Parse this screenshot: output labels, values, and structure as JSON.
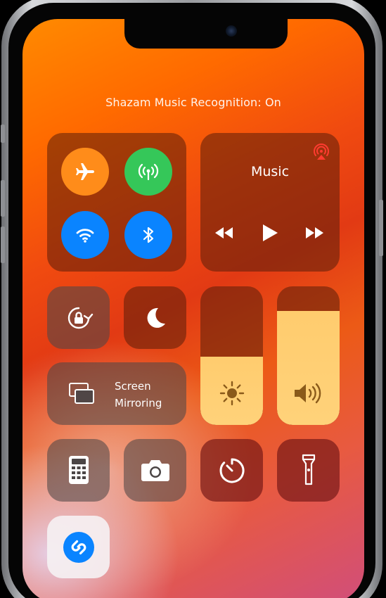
{
  "notification": {
    "banner": "Shazam Music Recognition: On"
  },
  "connectivity": {
    "airplane": {
      "icon": "airplane-icon",
      "color": "#ff8c1a"
    },
    "cellular": {
      "icon": "cellular-antenna-icon",
      "color": "#35c759"
    },
    "wifi": {
      "icon": "wifi-icon",
      "color": "#0a84ff"
    },
    "bluetooth": {
      "icon": "bluetooth-icon",
      "color": "#0a84ff"
    }
  },
  "music": {
    "title": "Music",
    "airplay_icon": "airplay-icon",
    "controls": [
      "rewind-icon",
      "play-icon",
      "fast-forward-icon"
    ]
  },
  "screen_mirroring": {
    "line1": "Screen",
    "line2": "Mirroring",
    "icon": "screen-mirroring-icon"
  },
  "brightness": {
    "level": 0.49,
    "icon": "sun-icon"
  },
  "volume": {
    "level": 0.82,
    "icon": "speaker-icon"
  },
  "toggles": [
    {
      "name": "orientation-lock",
      "icon": "rotation-lock-icon"
    },
    {
      "name": "do-not-disturb",
      "icon": "moon-icon"
    }
  ],
  "app_shortcuts": [
    "calculator-icon",
    "camera-icon",
    "timer-icon",
    "flashlight-icon"
  ],
  "shazam": {
    "icon": "shazam-icon",
    "color": "#0a84ff"
  }
}
